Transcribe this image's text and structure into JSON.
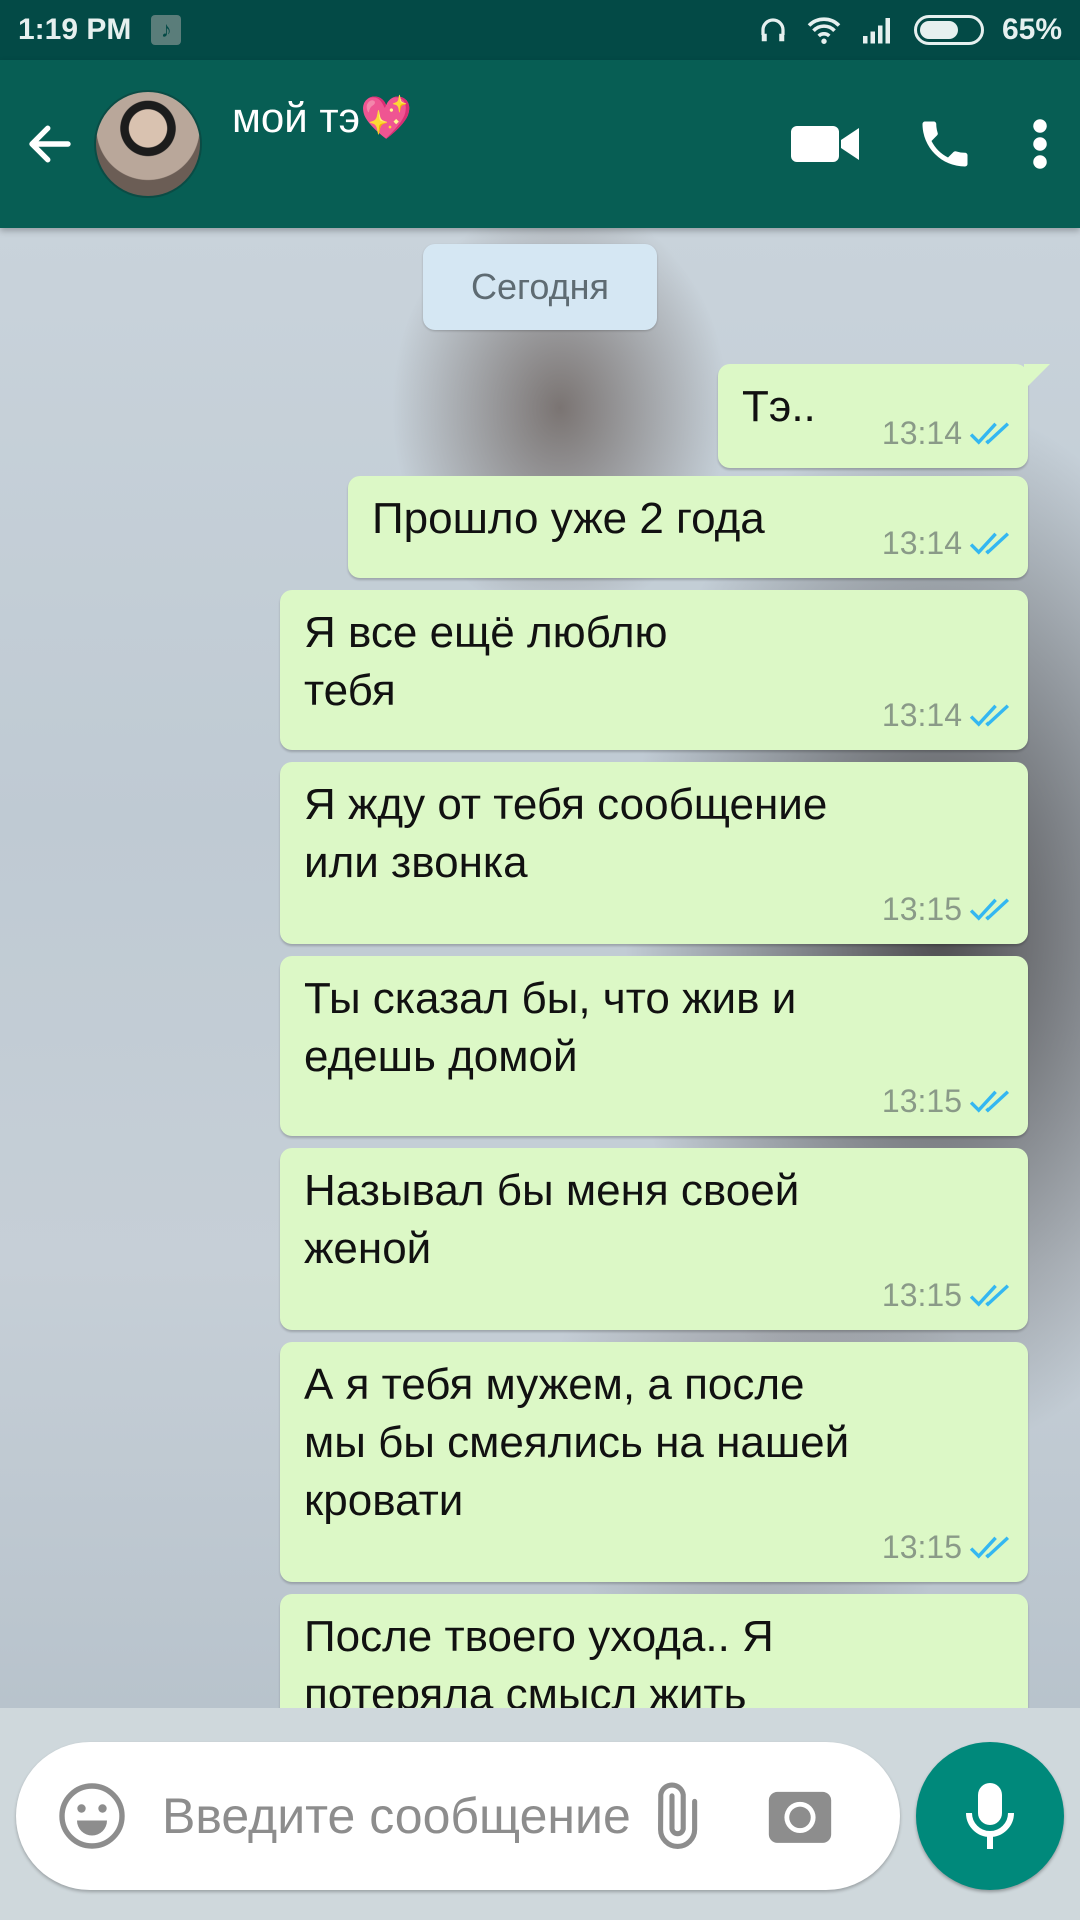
{
  "status_bar": {
    "time": "1:19 PM",
    "notification_icon": "tiktok-icon",
    "battery": "65%",
    "battery_level": 0.65
  },
  "header": {
    "contact_name": "мой тэ💖",
    "icons": [
      "back-arrow-icon",
      "video-call-icon",
      "phone-icon",
      "more-vert-icon"
    ]
  },
  "chat": {
    "date_chip": "Сегодня",
    "messages": [
      {
        "text": "Тэ..",
        "time": "13:14"
      },
      {
        "text": "Прошло уже 2 года",
        "time": "13:14"
      },
      {
        "text": "Я все ещё люблю\nтебя",
        "time": "13:14"
      },
      {
        "text": "Я жду от тебя сообщение\nили звонка",
        "time": "13:15"
      },
      {
        "text": "Ты сказал бы, что жив и\nедешь домой",
        "time": "13:15"
      },
      {
        "text": "Называл бы меня своей\nженой",
        "time": "13:15"
      },
      {
        "text": "А я тебя мужем, а после\nмы бы смеялись на нашей\nкровати",
        "time": "13:15"
      },
      {
        "text": "После твоего ухода.. Я\nпотеряла смысл жить",
        "time": ""
      }
    ]
  },
  "input": {
    "placeholder": "Введите сообщение"
  },
  "colors": {
    "header": "#075e54",
    "status_bar": "#034a46",
    "bubble": "#dcf8c6",
    "read_ticks": "#34b7f1",
    "mic_button": "#00897b"
  }
}
